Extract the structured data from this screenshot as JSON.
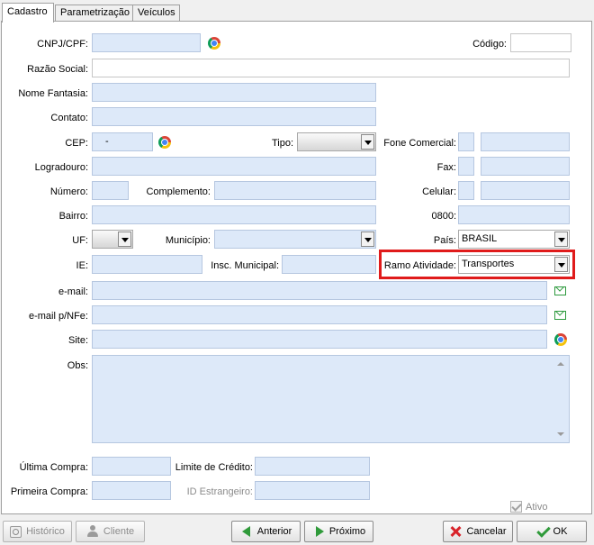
{
  "tabs": [
    "Cadastro",
    "Parametrização",
    "Veículos"
  ],
  "labels": {
    "cnpj": "CNPJ/CPF:",
    "codigo": "Código:",
    "razao_social": "Razão Social:",
    "nome_fantasia": "Nome Fantasia:",
    "contato": "Contato:",
    "cep": "CEP:",
    "tipo": "Tipo:",
    "fone_comercial": "Fone Comercial:",
    "logradouro": "Logradouro:",
    "fax": "Fax:",
    "numero": "Número:",
    "complemento": "Complemento:",
    "celular": "Celular:",
    "bairro": "Bairro:",
    "fone_0800": "0800:",
    "uf": "UF:",
    "municipio": "Município:",
    "pais": "País:",
    "ie": "IE:",
    "insc_municipal": "Insc. Municipal:",
    "ramo_atividade": "Ramo Atividade:",
    "email": "e-mail:",
    "email_nfe": "e-mail p/NFe:",
    "site": "Site:",
    "obs": "Obs:",
    "ultima_compra": "Última Compra:",
    "limite_credito": "Limite de Crédito:",
    "primeira_compra": "Primeira Compra:",
    "id_estrangeiro": "ID Estrangeiro:",
    "ativo": "Ativo"
  },
  "values": {
    "cep": "-",
    "pais": "BRASIL",
    "ramo_atividade": "Transportes"
  },
  "buttons": {
    "historico": "Histórico",
    "cliente": "Cliente",
    "anterior": "Anterior",
    "proximo": "Próximo",
    "cancelar": "Cancelar",
    "ok": "OK"
  },
  "icons": [
    "chrome-icon",
    "email-icon",
    "chevron-down-icon",
    "arrow-left-icon",
    "arrow-right-icon",
    "close-icon",
    "check-icon",
    "history-icon",
    "user-icon"
  ],
  "colors": {
    "field_bg": "#dde9f9",
    "highlight": "#e01b1b",
    "accent_green": "#2f9a3a",
    "cancel_red": "#d8232a"
  }
}
